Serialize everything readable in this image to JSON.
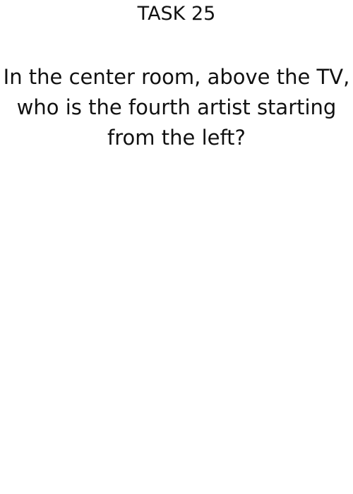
{
  "title": "TASK 25",
  "question": "In the center room, above the TV, who is the fourth artist starting from the left?"
}
